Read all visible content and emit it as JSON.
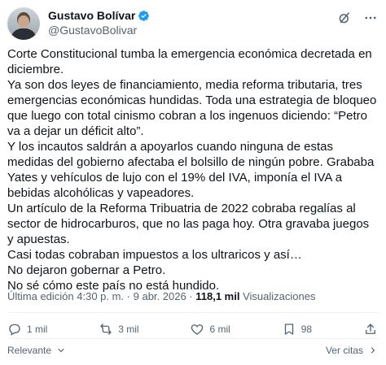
{
  "author": {
    "name": "Gustavo Bolívar",
    "handle": "@GustavoBolivar"
  },
  "tweet": {
    "paragraphs": [
      "Corte Constitucional tumba la emergencia económica decretada en diciembre.",
      "Ya son dos leyes de financiamiento, media reforma tributaria, tres emergencias económicas hundidas. Toda una estrategia de bloqueo que luego con total cinismo cobran a los ingenuos diciendo: “Petro va a dejar un déficit alto”.",
      "Y los incautos saldrán a apoyarlos cuando ninguna de estas medidas del gobierno afectaba el bolsillo de ningún pobre. Grababa Yates y vehículos de lujo con el 19% del IVA, imponía el IVA a bebidas alcohólicas y vapeadores.",
      "Un artículo de la Reforma Tribuatria de 2022 cobraba regalías al sector de hidrocarburos, que no las paga hoy. Otra gravaba juegos y apuestas.",
      "Casi todas cobraban impuestos a los ultraricos y así…",
      "No dejaron gobernar a Petro.",
      "No sé cómo este país no está hundido."
    ]
  },
  "meta": {
    "edited": "Última edición 4:30 p. m. · 9 abr. 2026 ·",
    "views_count": "118,1 mil",
    "views_label": "Visualizaciones"
  },
  "actions": {
    "replies": "1 mil",
    "reposts": "3 mil",
    "likes": "6 mil",
    "bookmarks": "98"
  },
  "footer": {
    "sort_label": "Relevante",
    "quotes_link": "Ver citas"
  },
  "colors": {
    "verified": "#1d9bf0",
    "muted": "#536471",
    "text": "#0f1419"
  }
}
